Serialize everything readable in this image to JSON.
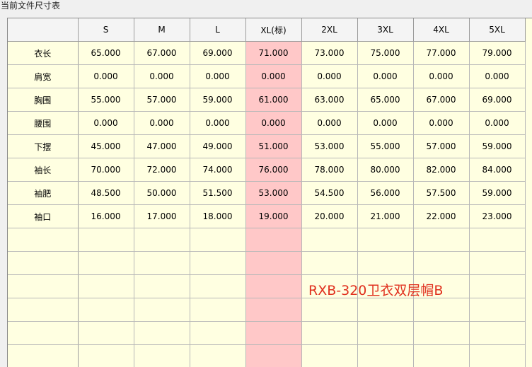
{
  "window": {
    "title": "当前文件尺寸表"
  },
  "table": {
    "columns": [
      "S",
      "M",
      "L",
      "XL(标)",
      "2XL",
      "3XL",
      "4XL",
      "5XL"
    ],
    "highlight_column_index": 3,
    "rows": [
      {
        "label": "衣长",
        "values": [
          "65.000",
          "67.000",
          "69.000",
          "71.000",
          "73.000",
          "75.000",
          "77.000",
          "79.000"
        ]
      },
      {
        "label": "肩宽",
        "values": [
          "0.000",
          "0.000",
          "0.000",
          "0.000",
          "0.000",
          "0.000",
          "0.000",
          "0.000"
        ]
      },
      {
        "label": "胸围",
        "values": [
          "55.000",
          "57.000",
          "59.000",
          "61.000",
          "63.000",
          "65.000",
          "67.000",
          "69.000"
        ]
      },
      {
        "label": "腰围",
        "values": [
          "0.000",
          "0.000",
          "0.000",
          "0.000",
          "0.000",
          "0.000",
          "0.000",
          "0.000"
        ]
      },
      {
        "label": "下摆",
        "values": [
          "45.000",
          "47.000",
          "49.000",
          "51.000",
          "53.000",
          "55.000",
          "57.000",
          "59.000"
        ]
      },
      {
        "label": "袖长",
        "values": [
          "70.000",
          "72.000",
          "74.000",
          "76.000",
          "78.000",
          "80.000",
          "82.000",
          "84.000"
        ]
      },
      {
        "label": "袖肥",
        "values": [
          "48.500",
          "50.000",
          "51.500",
          "53.000",
          "54.500",
          "56.000",
          "57.500",
          "59.000"
        ]
      },
      {
        "label": "袖口",
        "values": [
          "16.000",
          "17.000",
          "18.000",
          "19.000",
          "20.000",
          "21.000",
          "22.000",
          "23.000"
        ]
      }
    ],
    "empty_rows": 6
  },
  "overlay": {
    "text": "RXB-320卫衣双层帽B"
  },
  "colors": {
    "cell_background": "#ffffe1",
    "highlight_column": "#ffc8c8",
    "header_background": "#f4f4f4",
    "overlay_text": "#e0301e"
  }
}
